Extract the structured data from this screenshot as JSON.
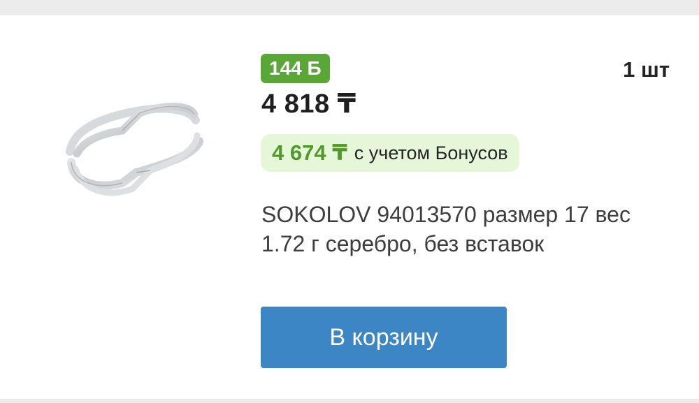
{
  "product": {
    "bonus_points": "144 Б",
    "quantity": "1 шт",
    "price": "4 818 ₸",
    "bonus_price": {
      "value": "4 674 ₸",
      "note": "с учетом Бонусов"
    },
    "description": "SOKOLOV 94013570 размер 17 вес 1.72 г серебро, без вставок",
    "image_icon": "silver-ring"
  },
  "actions": {
    "add_to_cart_label": "В корзину"
  },
  "colors": {
    "bonus_badge": "#5aa636",
    "bonus_price_bg": "#e5f6d9",
    "bonus_price_text": "#4f9a28",
    "button": "#3d86c6"
  }
}
